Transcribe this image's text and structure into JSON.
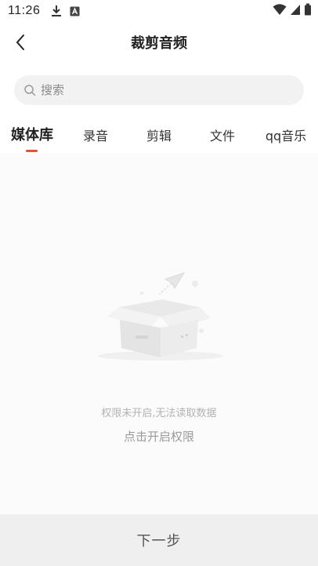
{
  "status_bar": {
    "time": "11:26",
    "icons": [
      "download-icon",
      "a-badge-icon",
      "wifi-icon",
      "signal-icon",
      "battery-icon"
    ]
  },
  "header": {
    "title": "裁剪音频",
    "back_icon": "chevron-left-icon"
  },
  "search": {
    "placeholder": "搜索",
    "value": ""
  },
  "tabs": [
    {
      "label": "媒体库",
      "active": true
    },
    {
      "label": "录音",
      "active": false
    },
    {
      "label": "剪辑",
      "active": false
    },
    {
      "label": "文件",
      "active": false
    },
    {
      "label": "qq音乐",
      "active": false
    }
  ],
  "empty_state": {
    "message": "权限未开启,无法读取数据",
    "action_label": "点击开启权限",
    "illustration_icon": "empty-box-icon"
  },
  "footer": {
    "next_label": "下一步"
  },
  "colors": {
    "accent": "#e84e3c",
    "search_bg": "#f2f2f2",
    "content_bg": "#fbfbfb",
    "footer_bg": "#efefef"
  }
}
